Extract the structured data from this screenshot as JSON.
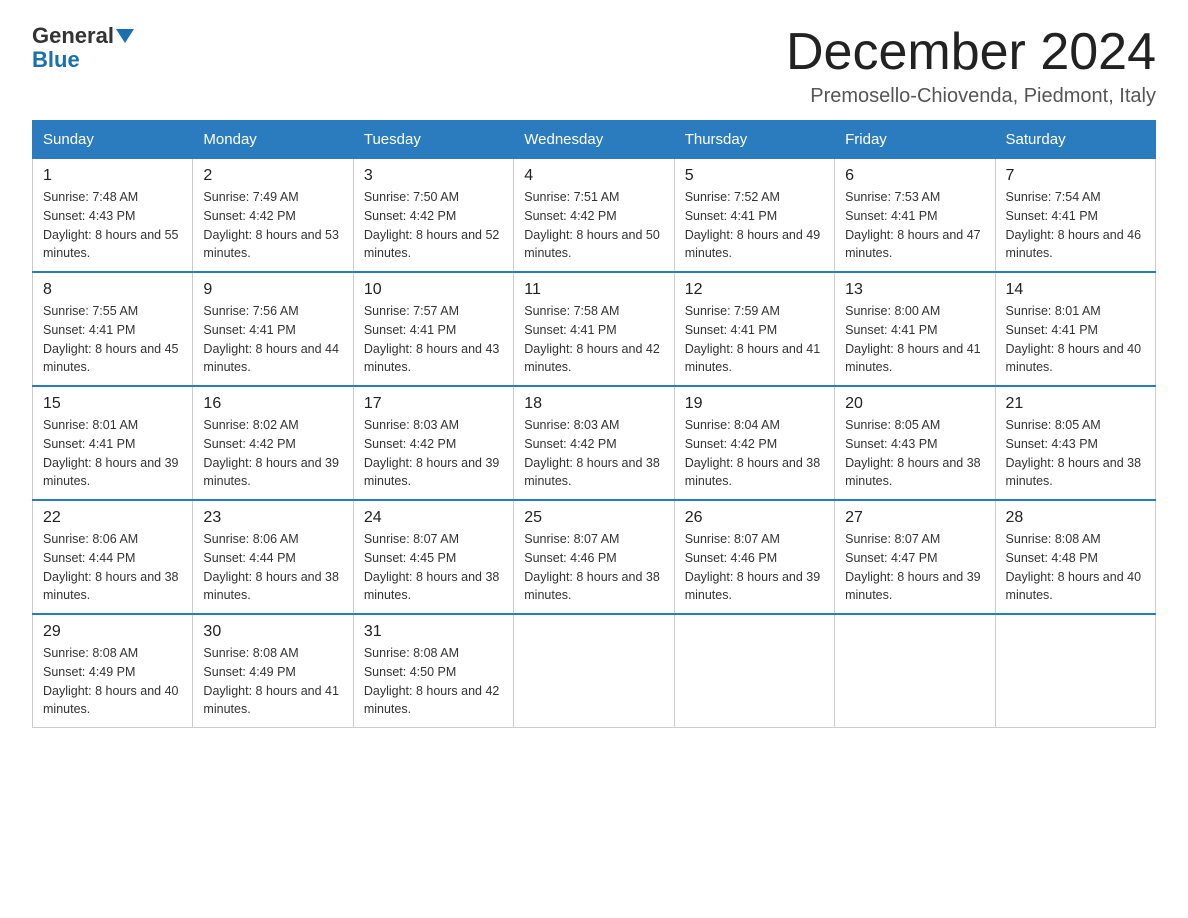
{
  "header": {
    "logo_general": "General",
    "logo_blue": "Blue",
    "month_title": "December 2024",
    "location": "Premosello-Chiovenda, Piedmont, Italy"
  },
  "weekdays": [
    "Sunday",
    "Monday",
    "Tuesday",
    "Wednesday",
    "Thursday",
    "Friday",
    "Saturday"
  ],
  "weeks": [
    [
      {
        "day": "1",
        "sunrise": "7:48 AM",
        "sunset": "4:43 PM",
        "daylight": "8 hours and 55 minutes."
      },
      {
        "day": "2",
        "sunrise": "7:49 AM",
        "sunset": "4:42 PM",
        "daylight": "8 hours and 53 minutes."
      },
      {
        "day": "3",
        "sunrise": "7:50 AM",
        "sunset": "4:42 PM",
        "daylight": "8 hours and 52 minutes."
      },
      {
        "day": "4",
        "sunrise": "7:51 AM",
        "sunset": "4:42 PM",
        "daylight": "8 hours and 50 minutes."
      },
      {
        "day": "5",
        "sunrise": "7:52 AM",
        "sunset": "4:41 PM",
        "daylight": "8 hours and 49 minutes."
      },
      {
        "day": "6",
        "sunrise": "7:53 AM",
        "sunset": "4:41 PM",
        "daylight": "8 hours and 47 minutes."
      },
      {
        "day": "7",
        "sunrise": "7:54 AM",
        "sunset": "4:41 PM",
        "daylight": "8 hours and 46 minutes."
      }
    ],
    [
      {
        "day": "8",
        "sunrise": "7:55 AM",
        "sunset": "4:41 PM",
        "daylight": "8 hours and 45 minutes."
      },
      {
        "day": "9",
        "sunrise": "7:56 AM",
        "sunset": "4:41 PM",
        "daylight": "8 hours and 44 minutes."
      },
      {
        "day": "10",
        "sunrise": "7:57 AM",
        "sunset": "4:41 PM",
        "daylight": "8 hours and 43 minutes."
      },
      {
        "day": "11",
        "sunrise": "7:58 AM",
        "sunset": "4:41 PM",
        "daylight": "8 hours and 42 minutes."
      },
      {
        "day": "12",
        "sunrise": "7:59 AM",
        "sunset": "4:41 PM",
        "daylight": "8 hours and 41 minutes."
      },
      {
        "day": "13",
        "sunrise": "8:00 AM",
        "sunset": "4:41 PM",
        "daylight": "8 hours and 41 minutes."
      },
      {
        "day": "14",
        "sunrise": "8:01 AM",
        "sunset": "4:41 PM",
        "daylight": "8 hours and 40 minutes."
      }
    ],
    [
      {
        "day": "15",
        "sunrise": "8:01 AM",
        "sunset": "4:41 PM",
        "daylight": "8 hours and 39 minutes."
      },
      {
        "day": "16",
        "sunrise": "8:02 AM",
        "sunset": "4:42 PM",
        "daylight": "8 hours and 39 minutes."
      },
      {
        "day": "17",
        "sunrise": "8:03 AM",
        "sunset": "4:42 PM",
        "daylight": "8 hours and 39 minutes."
      },
      {
        "day": "18",
        "sunrise": "8:03 AM",
        "sunset": "4:42 PM",
        "daylight": "8 hours and 38 minutes."
      },
      {
        "day": "19",
        "sunrise": "8:04 AM",
        "sunset": "4:42 PM",
        "daylight": "8 hours and 38 minutes."
      },
      {
        "day": "20",
        "sunrise": "8:05 AM",
        "sunset": "4:43 PM",
        "daylight": "8 hours and 38 minutes."
      },
      {
        "day": "21",
        "sunrise": "8:05 AM",
        "sunset": "4:43 PM",
        "daylight": "8 hours and 38 minutes."
      }
    ],
    [
      {
        "day": "22",
        "sunrise": "8:06 AM",
        "sunset": "4:44 PM",
        "daylight": "8 hours and 38 minutes."
      },
      {
        "day": "23",
        "sunrise": "8:06 AM",
        "sunset": "4:44 PM",
        "daylight": "8 hours and 38 minutes."
      },
      {
        "day": "24",
        "sunrise": "8:07 AM",
        "sunset": "4:45 PM",
        "daylight": "8 hours and 38 minutes."
      },
      {
        "day": "25",
        "sunrise": "8:07 AM",
        "sunset": "4:46 PM",
        "daylight": "8 hours and 38 minutes."
      },
      {
        "day": "26",
        "sunrise": "8:07 AM",
        "sunset": "4:46 PM",
        "daylight": "8 hours and 39 minutes."
      },
      {
        "day": "27",
        "sunrise": "8:07 AM",
        "sunset": "4:47 PM",
        "daylight": "8 hours and 39 minutes."
      },
      {
        "day": "28",
        "sunrise": "8:08 AM",
        "sunset": "4:48 PM",
        "daylight": "8 hours and 40 minutes."
      }
    ],
    [
      {
        "day": "29",
        "sunrise": "8:08 AM",
        "sunset": "4:49 PM",
        "daylight": "8 hours and 40 minutes."
      },
      {
        "day": "30",
        "sunrise": "8:08 AM",
        "sunset": "4:49 PM",
        "daylight": "8 hours and 41 minutes."
      },
      {
        "day": "31",
        "sunrise": "8:08 AM",
        "sunset": "4:50 PM",
        "daylight": "8 hours and 42 minutes."
      },
      null,
      null,
      null,
      null
    ]
  ]
}
